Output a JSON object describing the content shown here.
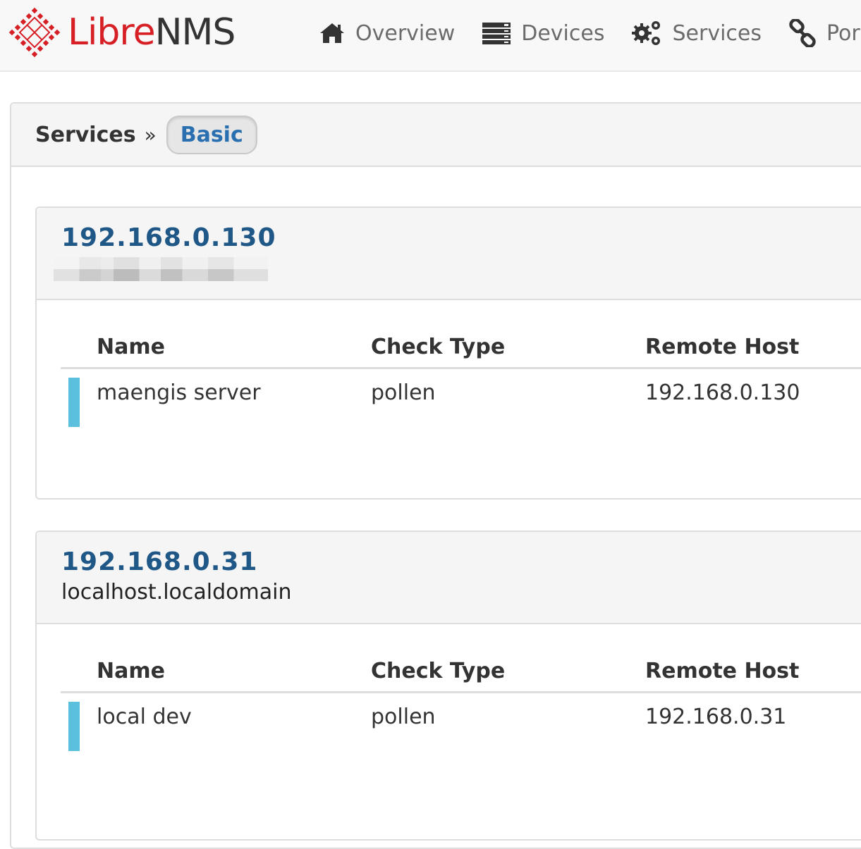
{
  "brand": {
    "name_libre": "Libre",
    "name_nms": "NMS",
    "logo_icon": "librenms-diamond-logo",
    "logo_color": "#d71f26"
  },
  "nav": {
    "items": [
      {
        "label": "Overview",
        "icon": "home-icon"
      },
      {
        "label": "Devices",
        "icon": "server-icon"
      },
      {
        "label": "Services",
        "icon": "cogs-icon"
      },
      {
        "label": "Por",
        "icon": "link-icon"
      }
    ]
  },
  "breadcrumb": {
    "title": "Services",
    "separator": "»",
    "current": "Basic"
  },
  "table_headers": {
    "name": "Name",
    "check_type": "Check Type",
    "remote_host": "Remote Host"
  },
  "devices": [
    {
      "ip": "192.168.0.130",
      "hostname": "",
      "hostname_redacted": true,
      "services": [
        {
          "name": "maengis server",
          "check_type": "pollen",
          "remote_host": "192.168.0.130",
          "status_color": "#5bc0de"
        }
      ]
    },
    {
      "ip": "192.168.0.31",
      "hostname": "localhost.localdomain",
      "hostname_redacted": false,
      "services": [
        {
          "name": "local dev",
          "check_type": "pollen",
          "remote_host": "192.168.0.31",
          "status_color": "#5bc0de"
        }
      ]
    }
  ],
  "colors": {
    "link": "#1f5787",
    "badge_text": "#2a6fb0",
    "status_ok": "#5bc0de"
  }
}
